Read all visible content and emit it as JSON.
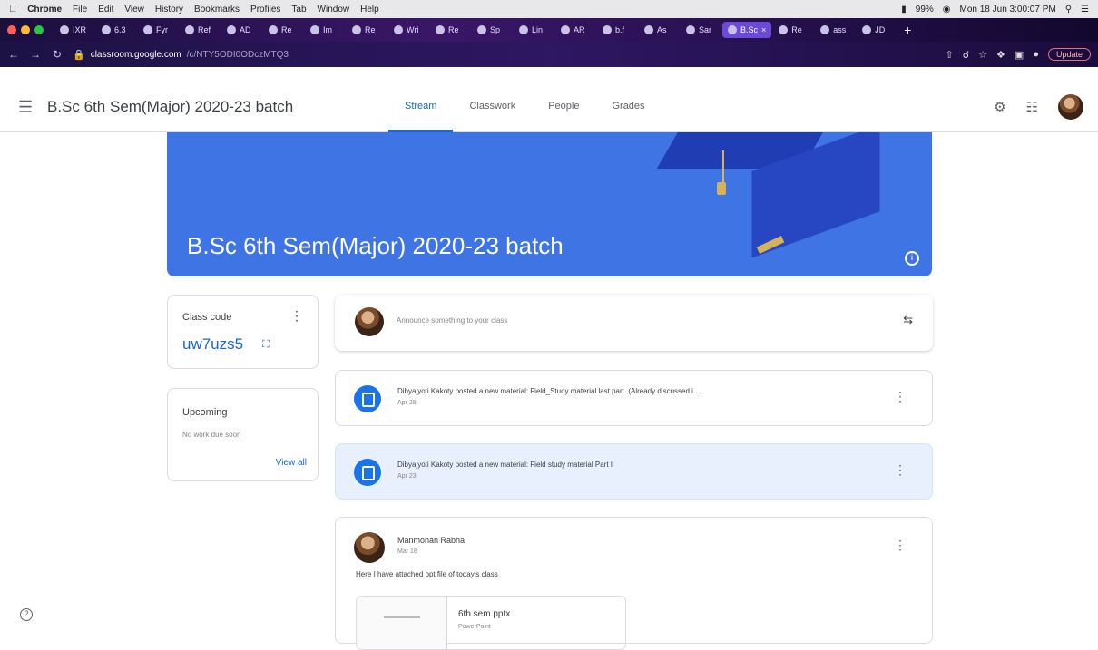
{
  "macos_menubar": {
    "app_name": "Chrome",
    "menus": [
      "File",
      "Edit",
      "View",
      "History",
      "Bookmarks",
      "Profiles",
      "Tab",
      "Window",
      "Help"
    ],
    "battery": "99%",
    "datetime": "Mon 18 Jun 3:00:07 PM"
  },
  "browser": {
    "tabs": [
      {
        "label": "IXR"
      },
      {
        "label": "6.3"
      },
      {
        "label": "Fyr"
      },
      {
        "label": "Ref"
      },
      {
        "label": "AD"
      },
      {
        "label": "Re"
      },
      {
        "label": "Im"
      },
      {
        "label": "Re"
      },
      {
        "label": "Wri"
      },
      {
        "label": "Re"
      },
      {
        "label": "Sp"
      },
      {
        "label": "Lin"
      },
      {
        "label": "AR"
      },
      {
        "label": "b.f"
      },
      {
        "label": "As"
      },
      {
        "label": "Sar"
      },
      {
        "label": "B.Sc",
        "active": true
      },
      {
        "label": "Re"
      },
      {
        "label": "ass"
      },
      {
        "label": "JD"
      }
    ],
    "url_host": "classroom.google.com",
    "url_path": "/c/NTY5ODI0ODczMTQ3",
    "update_label": "Update"
  },
  "appbar": {
    "title": "B.Sc 6th Sem(Major) 2020-23 batch",
    "tabs": [
      {
        "label": "Stream",
        "active": true
      },
      {
        "label": "Classwork"
      },
      {
        "label": "People"
      },
      {
        "label": "Grades"
      }
    ]
  },
  "banner": {
    "title": "B.Sc 6th Sem(Major) 2020-23 batch"
  },
  "class_code": {
    "label": "Class code",
    "code": "uw7uzs5"
  },
  "upcoming": {
    "label": "Upcoming",
    "empty_text": "No work due soon",
    "view_all": "View all"
  },
  "announce": {
    "placeholder": "Announce something to your class"
  },
  "posts": [
    {
      "title": "Dibyajyoti Kakoty posted a new material: Field_Study material last part. (Already discussed i...",
      "date": "Apr 28"
    },
    {
      "title": "Dibyajyoti Kakoty posted a new material: Field study material Part I",
      "date": "Apr 23"
    }
  ],
  "stream_post": {
    "author": "Manmohan Rabha",
    "date": "Mar 18",
    "body": "Here I have attached ppt file of today's class",
    "attachment_name": "6th sem.pptx",
    "attachment_type": "PowerPoint"
  },
  "colors": {
    "banner": "#3e74e3",
    "accent": "#1967d2"
  }
}
